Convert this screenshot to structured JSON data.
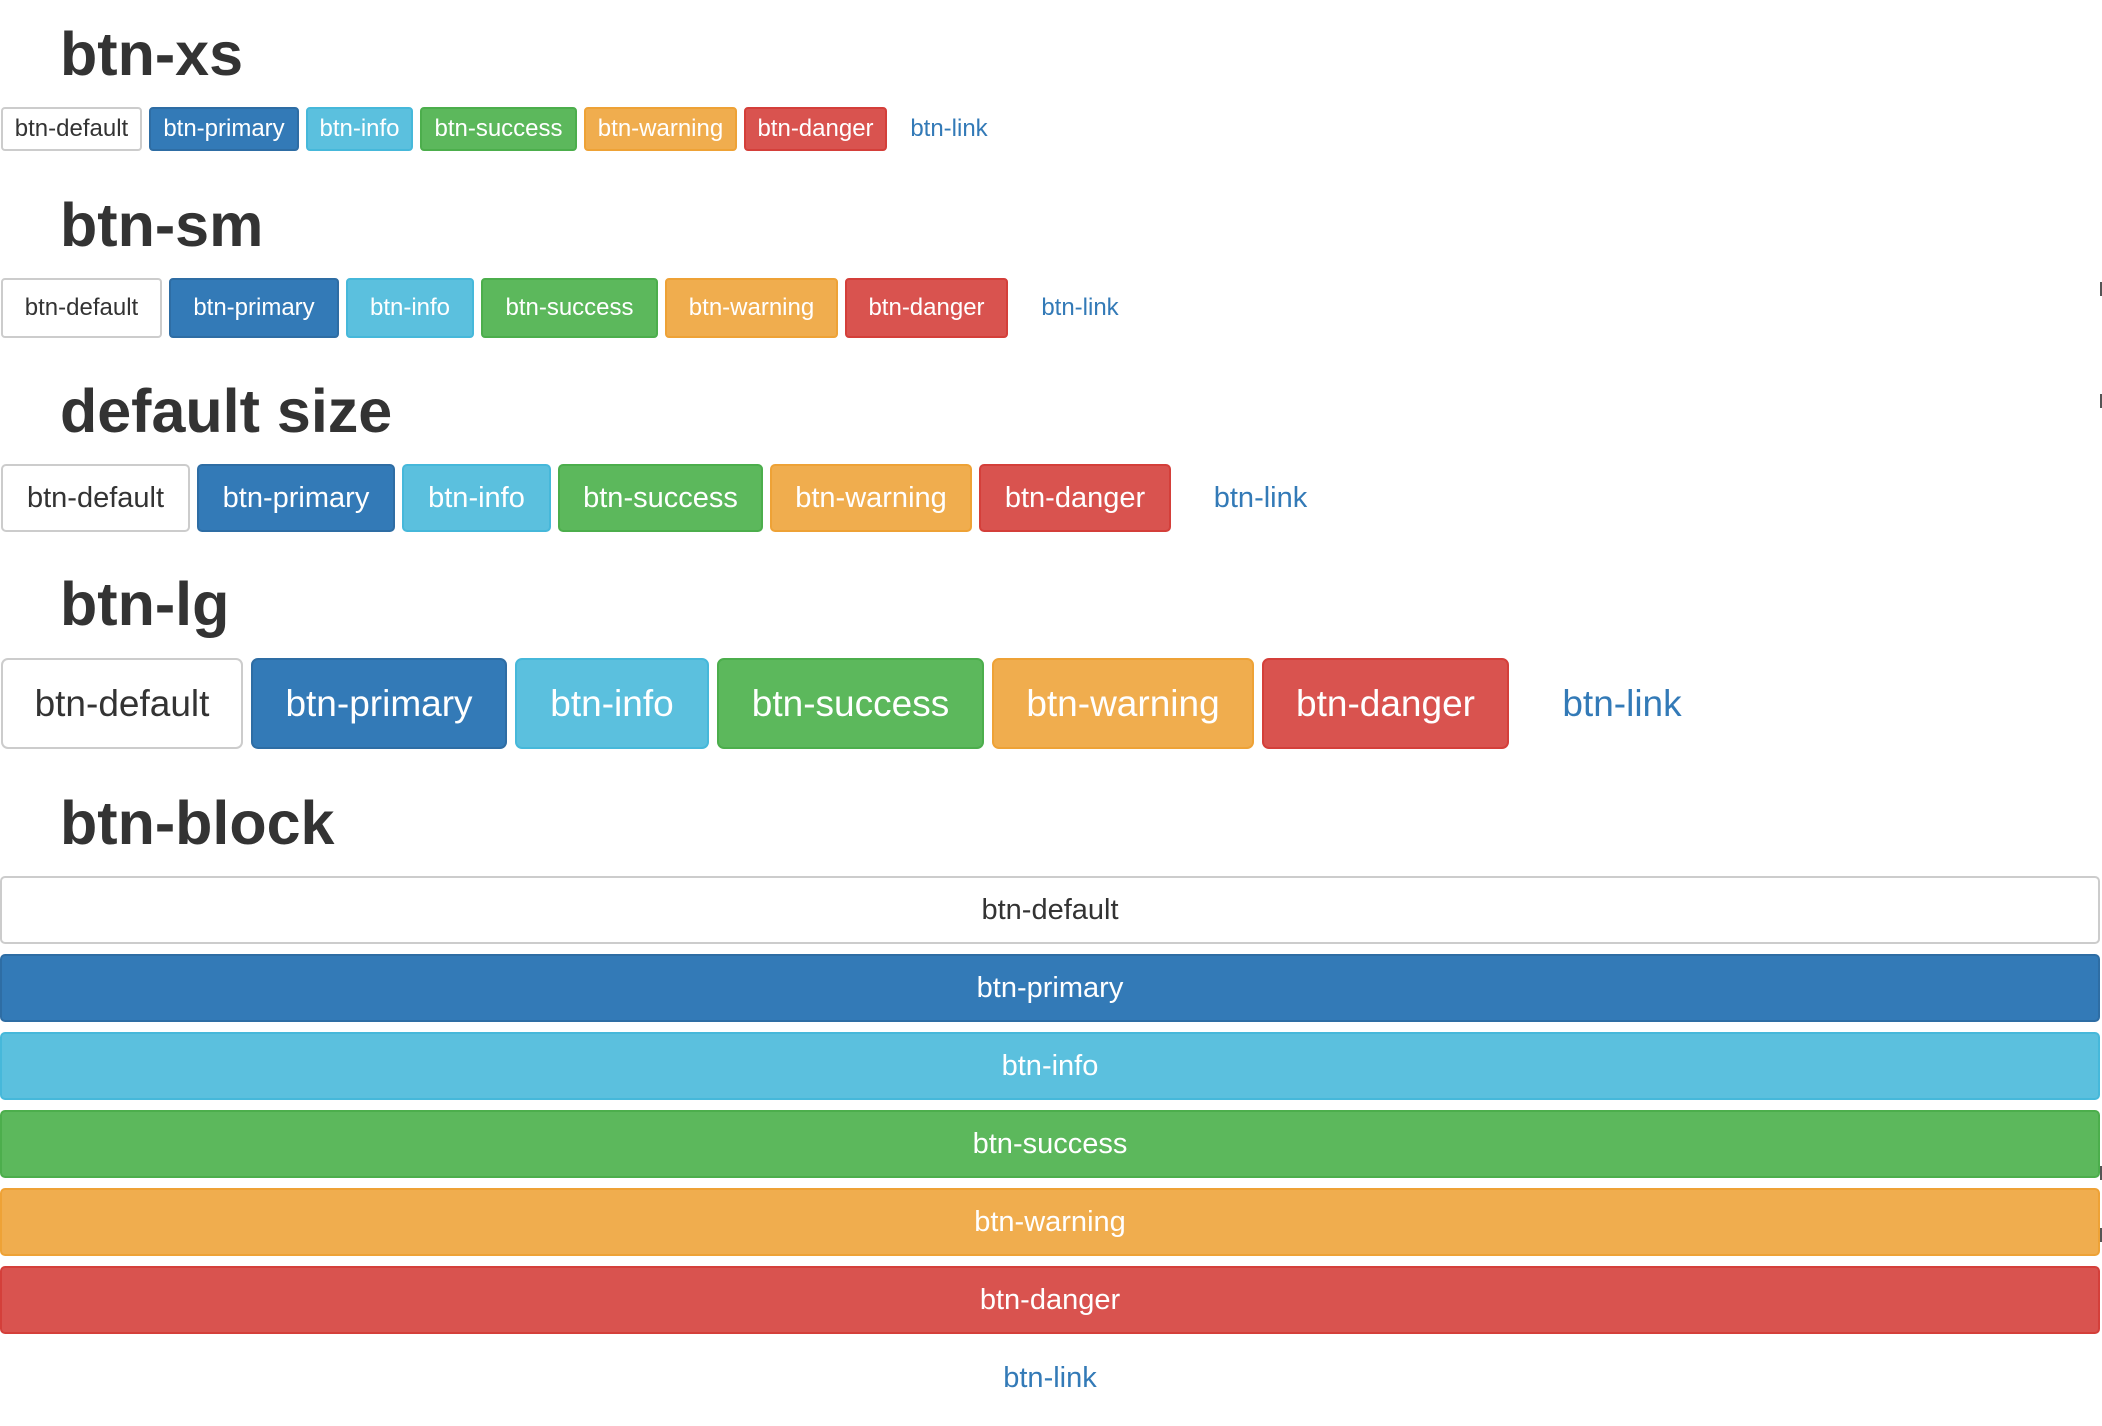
{
  "sections": {
    "xs": {
      "heading": "btn-xs",
      "buttons": {
        "default": "btn-default",
        "primary": "btn-primary",
        "info": "btn-info",
        "success": "btn-success",
        "warning": "btn-warning",
        "danger": "btn-danger",
        "link": "btn-link"
      }
    },
    "sm": {
      "heading": "btn-sm",
      "buttons": {
        "default": "btn-default",
        "primary": "btn-primary",
        "info": "btn-info",
        "success": "btn-success",
        "warning": "btn-warning",
        "danger": "btn-danger",
        "link": "btn-link"
      }
    },
    "md": {
      "heading": "default size",
      "buttons": {
        "default": "btn-default",
        "primary": "btn-primary",
        "info": "btn-info",
        "success": "btn-success",
        "warning": "btn-warning",
        "danger": "btn-danger",
        "link": "btn-link"
      }
    },
    "lg": {
      "heading": "btn-lg",
      "buttons": {
        "default": "btn-default",
        "primary": "btn-primary",
        "info": "btn-info",
        "success": "btn-success",
        "warning": "btn-warning",
        "danger": "btn-danger",
        "link": "btn-link"
      }
    },
    "block": {
      "heading": "btn-block",
      "buttons": {
        "default": "btn-default",
        "primary": "btn-primary",
        "info": "btn-info",
        "success": "btn-success",
        "warning": "btn-warning",
        "danger": "btn-danger",
        "link": "btn-link"
      }
    }
  },
  "colors": {
    "default_bg": "#ffffff",
    "default_border": "#cccccc",
    "primary": "#337ab7",
    "info": "#5bc0de",
    "success": "#5cb85c",
    "warning": "#f0ad4e",
    "danger": "#d9534f",
    "link": "#337ab7",
    "heading_text": "#333333"
  }
}
